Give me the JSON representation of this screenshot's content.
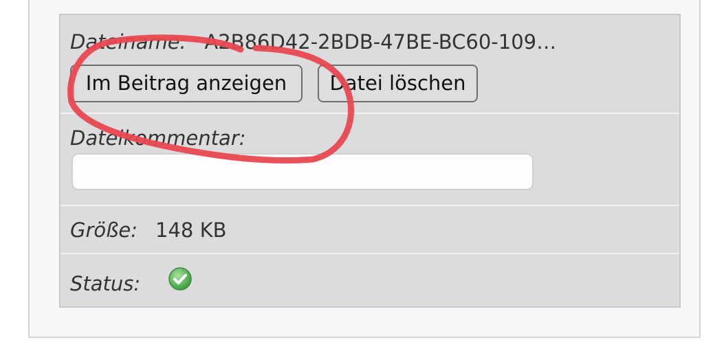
{
  "attachment": {
    "filename_label": "Dateiname:",
    "filename_value": "A2B86D42-2BDB-47BE-BC60-109…",
    "show_in_post_button": "Im Beitrag anzeigen",
    "delete_file_button": "Datei löschen",
    "comment_label": "Dateikommentar:",
    "comment_value": "",
    "size_label": "Größe:",
    "size_value": "148 KB",
    "status_label": "Status:",
    "status_icon": "check-circle-icon"
  },
  "colors": {
    "annotation_stroke": "#e8474f",
    "status_ok": "#5cb85c"
  }
}
